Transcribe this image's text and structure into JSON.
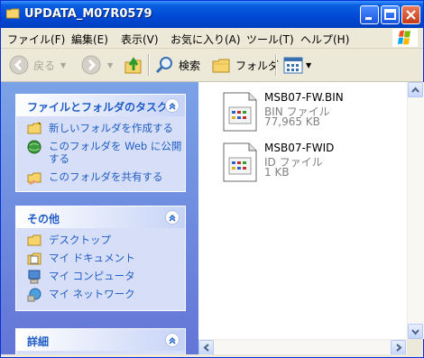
{
  "window": {
    "title": "UPDATA_M07R0579"
  },
  "menu": [
    "ファイル(F)",
    "編集(E)",
    "表示(V)",
    "お気に入り(A)",
    "ツール(T)",
    "ヘルプ(H)"
  ],
  "toolbar": {
    "back": "戻る",
    "search": "検索",
    "folders": "フォルダ"
  },
  "tasks": {
    "file_folder": {
      "title": "ファイルとフォルダのタスク",
      "links": [
        "新しいフォルダを作成する",
        "このフォルダを Web に公開する",
        "このフォルダを共有する"
      ]
    },
    "other": {
      "title": "その他",
      "links": [
        "デスクトップ",
        "マイ ドキュメント",
        "マイ コンピュータ",
        "マイ ネットワーク"
      ]
    },
    "details": {
      "title": "詳細"
    }
  },
  "files": [
    {
      "name": "MSB07-FW.BIN",
      "type": "BIN ファイル",
      "size": "77,965 KB"
    },
    {
      "name": "MSB07-FWID",
      "type": "ID ファイル",
      "size": "1 KB"
    }
  ]
}
